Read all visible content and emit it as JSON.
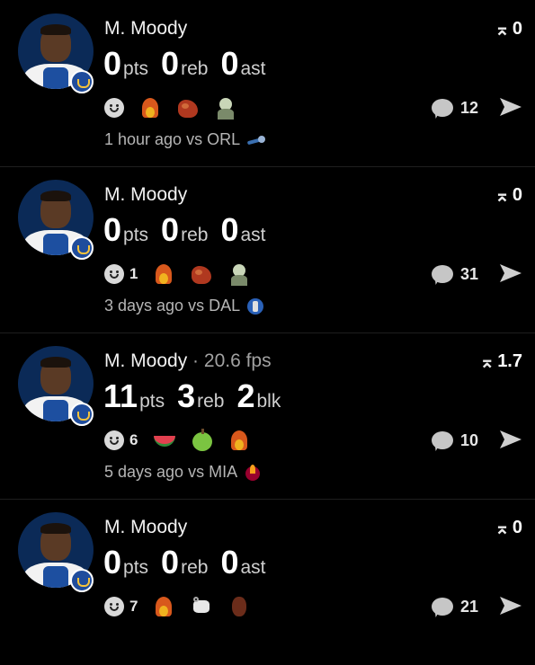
{
  "feed": [
    {
      "player": "M. Moody",
      "fps_sep": "",
      "fps": "",
      "stats": [
        {
          "value": "0",
          "unit": "pts"
        },
        {
          "value": "0",
          "unit": "reb"
        },
        {
          "value": "0",
          "unit": "ast"
        }
      ],
      "reaction_count": "",
      "reactions": [
        "flame",
        "muscle",
        "baby"
      ],
      "comments": "12",
      "score": "0",
      "time": "1 hour ago vs ORL",
      "team_logo": "orl"
    },
    {
      "player": "M. Moody",
      "fps_sep": "",
      "fps": "",
      "stats": [
        {
          "value": "0",
          "unit": "pts"
        },
        {
          "value": "0",
          "unit": "reb"
        },
        {
          "value": "0",
          "unit": "ast"
        }
      ],
      "reaction_count": "1",
      "reactions": [
        "flame",
        "muscle",
        "baby"
      ],
      "comments": "31",
      "score": "0",
      "time": "3 days ago vs DAL",
      "team_logo": "dal"
    },
    {
      "player": "M. Moody",
      "fps_sep": "·",
      "fps": "20.6 fps",
      "stats": [
        {
          "value": "11",
          "unit": "pts"
        },
        {
          "value": "3",
          "unit": "reb"
        },
        {
          "value": "2",
          "unit": "blk"
        }
      ],
      "reaction_count": "6",
      "reactions": [
        "melon",
        "apple",
        "flame"
      ],
      "comments": "10",
      "score": "1.7",
      "time": "5 days ago vs MIA",
      "team_logo": "mia"
    },
    {
      "player": "M. Moody",
      "fps_sep": "",
      "fps": "",
      "stats": [
        {
          "value": "0",
          "unit": "pts"
        },
        {
          "value": "0",
          "unit": "reb"
        },
        {
          "value": "0",
          "unit": "ast"
        }
      ],
      "reaction_count": "7",
      "reactions": [
        "flame",
        "goat",
        "face"
      ],
      "comments": "21",
      "score": "0",
      "time": "",
      "team_logo": ""
    }
  ]
}
